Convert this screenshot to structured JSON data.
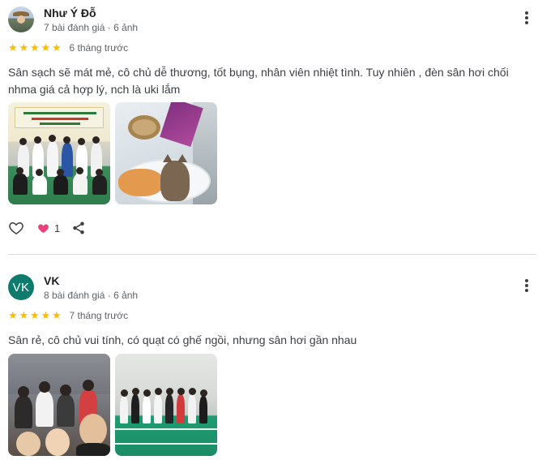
{
  "reviews": [
    {
      "author": "Như Ý Đỗ",
      "avatar_type": "photo",
      "meta": "7 bài đánh giá · 6 ảnh",
      "rating": 5,
      "stars": "★★★★★",
      "time": "6 tháng trước",
      "text": "Sân sạch sẽ mát mẻ, cô chủ dễ thương, tốt bụng, nhân viên nhiệt tình. Tuy nhiên , đèn sân hơi chối nhma giá cả hợp lý, nch là uki lắm",
      "photos": [
        "team-group-photo",
        "cat-photo"
      ],
      "reactions": {
        "like_icon": "heart-outline-icon",
        "reaction_icon": "heart-filled-icon",
        "count": "1",
        "share_icon": "share-icon"
      }
    },
    {
      "author": "VK",
      "avatar_letters": "VK",
      "avatar_color": "#0f7b6c",
      "meta": "8 bài đánh giá · 6 ảnh",
      "rating": 5,
      "stars": "★★★★★",
      "time": "7 tháng trước",
      "text": "Sân rẻ, cô chủ vui tính, có quạt có ghế ngồi, nhưng sân hơi gần nhau",
      "photos": [
        "indoor-group-selfie-photo",
        "court-group-photo"
      ]
    }
  ],
  "colors": {
    "star": "#fbbc04",
    "heart": "#e8437a",
    "divider": "#dadce0"
  }
}
